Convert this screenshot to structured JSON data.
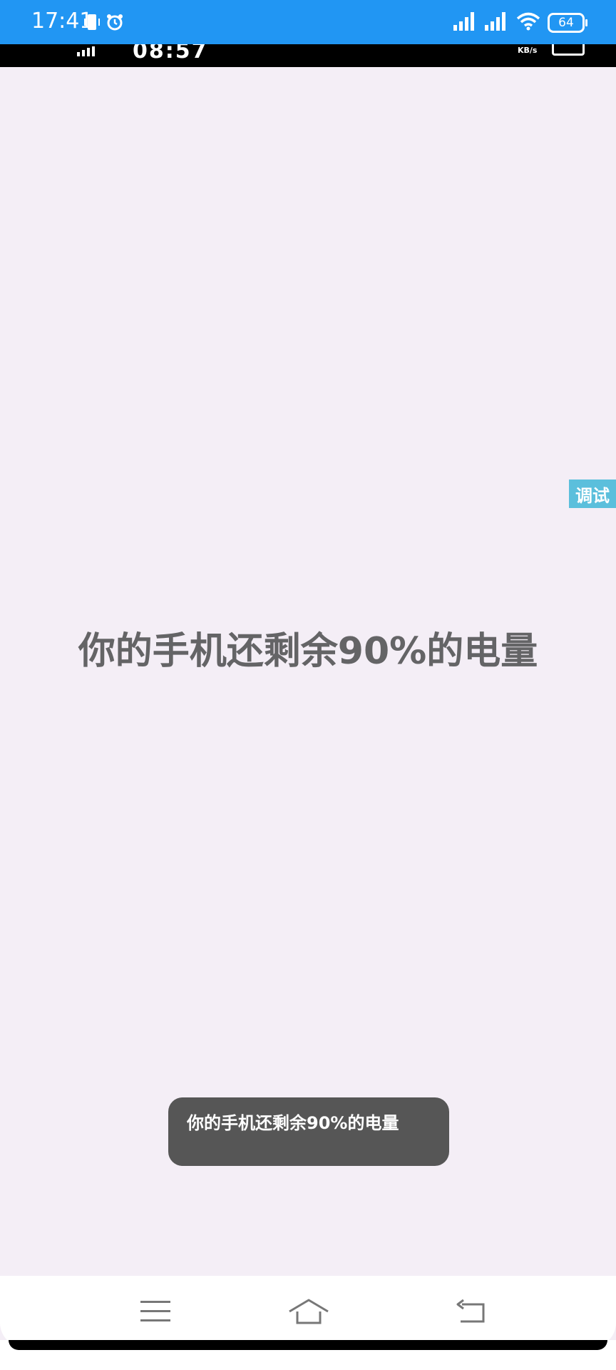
{
  "status_bar": {
    "time": "17:41",
    "battery": "64",
    "colors": {
      "background": "#2196f3",
      "foreground": "#ffffff"
    },
    "icons": [
      "phone-vibrate-icon",
      "alarm-clock-icon",
      "signal-icon",
      "signal-icon",
      "wifi-icon",
      "battery-icon"
    ]
  },
  "inner_status": {
    "time": "08:57",
    "speed_unit": "KB/s"
  },
  "debug_tab": {
    "label": "调试",
    "color": "#5bbfdc"
  },
  "main": {
    "message": "你的手机还剩余90%的电量",
    "background": "#f4eef6",
    "text_color": "#646466"
  },
  "toast": {
    "text": "你的手机还剩余90%的电量"
  },
  "nav_bar": {
    "icons": [
      "menu-icon",
      "home-icon",
      "back-icon"
    ]
  }
}
